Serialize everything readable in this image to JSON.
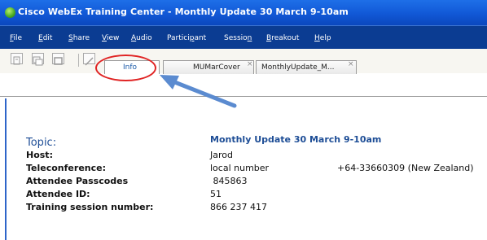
{
  "window": {
    "title": "Cisco WebEx Training Center - Monthly Update 30 March 9-10am"
  },
  "menu": [
    {
      "pre": "",
      "u": "F",
      "post": "ile"
    },
    {
      "pre": "",
      "u": "E",
      "post": "dit"
    },
    {
      "pre": "",
      "u": "S",
      "post": "hare"
    },
    {
      "pre": "",
      "u": "V",
      "post": "iew"
    },
    {
      "pre": "",
      "u": "A",
      "post": "udio"
    },
    {
      "pre": "Partici",
      "u": "p",
      "post": "ant"
    },
    {
      "pre": "Sessio",
      "u": "n",
      "post": ""
    },
    {
      "pre": "",
      "u": "B",
      "post": "reakout"
    },
    {
      "pre": "",
      "u": "H",
      "post": "elp"
    }
  ],
  "tabs": [
    {
      "label": "Info",
      "close": ""
    },
    {
      "label": "MUMarCover",
      "close": "×"
    },
    {
      "label": "MonthlyUpdate_M...",
      "close": "×"
    }
  ],
  "info": {
    "topic_label": "Topic:",
    "topic_value": "Monthly Update 30 March 9-10am",
    "rows": [
      {
        "label": "Host:",
        "value": "Jarod",
        "extra": ""
      },
      {
        "label": "Teleconference:",
        "value": "local number",
        "extra": "+64-33660309  (New Zealand)"
      },
      {
        "label": "Attendee Passcodes",
        "value": " 845863",
        "extra": ""
      },
      {
        "label": "Attendee ID:",
        "value": "51",
        "extra": ""
      },
      {
        "label": "Training session number:",
        "value": "866 237 417",
        "extra": ""
      }
    ]
  },
  "colors": {
    "title_bar": "#1158d6",
    "menu_bar": "#0b3c92",
    "accent_text": "#1d4d96",
    "annotation_circle": "#e02424",
    "annotation_arrow": "#5b8bd0"
  },
  "icons": [
    "new-page-icon",
    "new-window-icon",
    "full-screen-icon",
    "annotate-icon",
    "webex-logo-icon"
  ]
}
